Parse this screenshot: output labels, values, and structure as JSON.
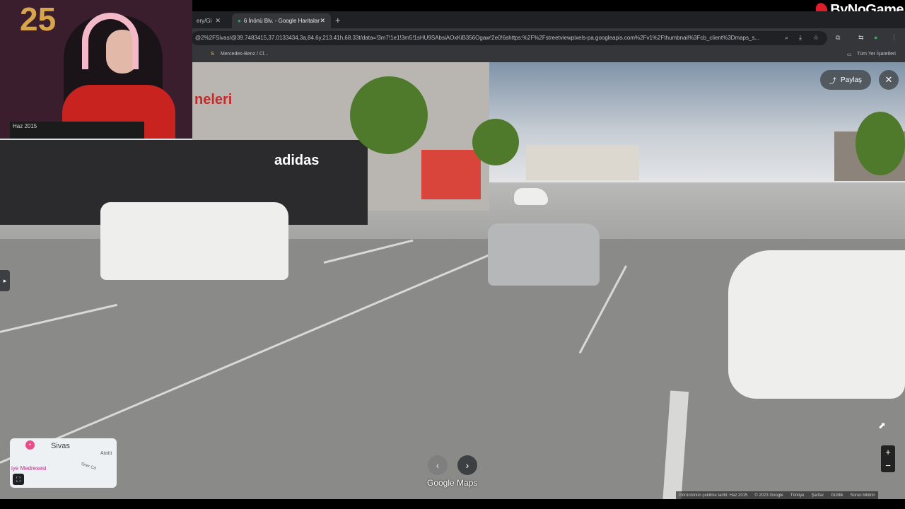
{
  "branding": {
    "name": "ByNoGame"
  },
  "webcam": {
    "balloon_text": "25",
    "caption": "Haz 2015"
  },
  "browser": {
    "tabs": [
      {
        "label": "ery/Gi",
        "state": "inactive"
      },
      {
        "label": "6 İnönü Blv. - Google Haritalar",
        "state": "active"
      }
    ],
    "new_tab": "+",
    "url": "@2%2FSivas/@39.7483415,37.0133434,3a,84.6y,213.41h,68.33t/data=!3m7!1e1!3m5!1sHU9SAbsiAOxKiB356Ogaw!2e0!6shttps:%2F%2Fstreetviewpixels-pa.googleapis.com%2Fv1%2Fthumbnail%3Fcb_client%3Dmaps_s...",
    "bookmarks": [
      "Mercedes-Benz / Cl...",
      "Tüm Yer İşaretleri"
    ]
  },
  "streetview": {
    "share_label": "Paylaş",
    "scene_signs": {
      "store1": "adidas",
      "store2": "neleri"
    },
    "minimap": {
      "city": "Sivas",
      "street1": "Atatü",
      "street2": "Sirer Cd",
      "poi": "iye Medresesi"
    },
    "brand_label": "Google Maps",
    "footer": [
      "Görüntünün çekilme tarihi: Haz 2015",
      "© 2023 Google",
      "Türkiye",
      "Şartlar",
      "Gizlilik",
      "Sorun bildirin"
    ]
  },
  "icons": {
    "share": "share-icon",
    "close": "close-icon",
    "prev": "chevron-left-icon",
    "next": "chevron-right-icon",
    "zoom_in": "plus-icon",
    "zoom_out": "minus-icon"
  },
  "colors": {
    "accent_red": "#e21d2a",
    "chrome_dark": "#202124"
  }
}
